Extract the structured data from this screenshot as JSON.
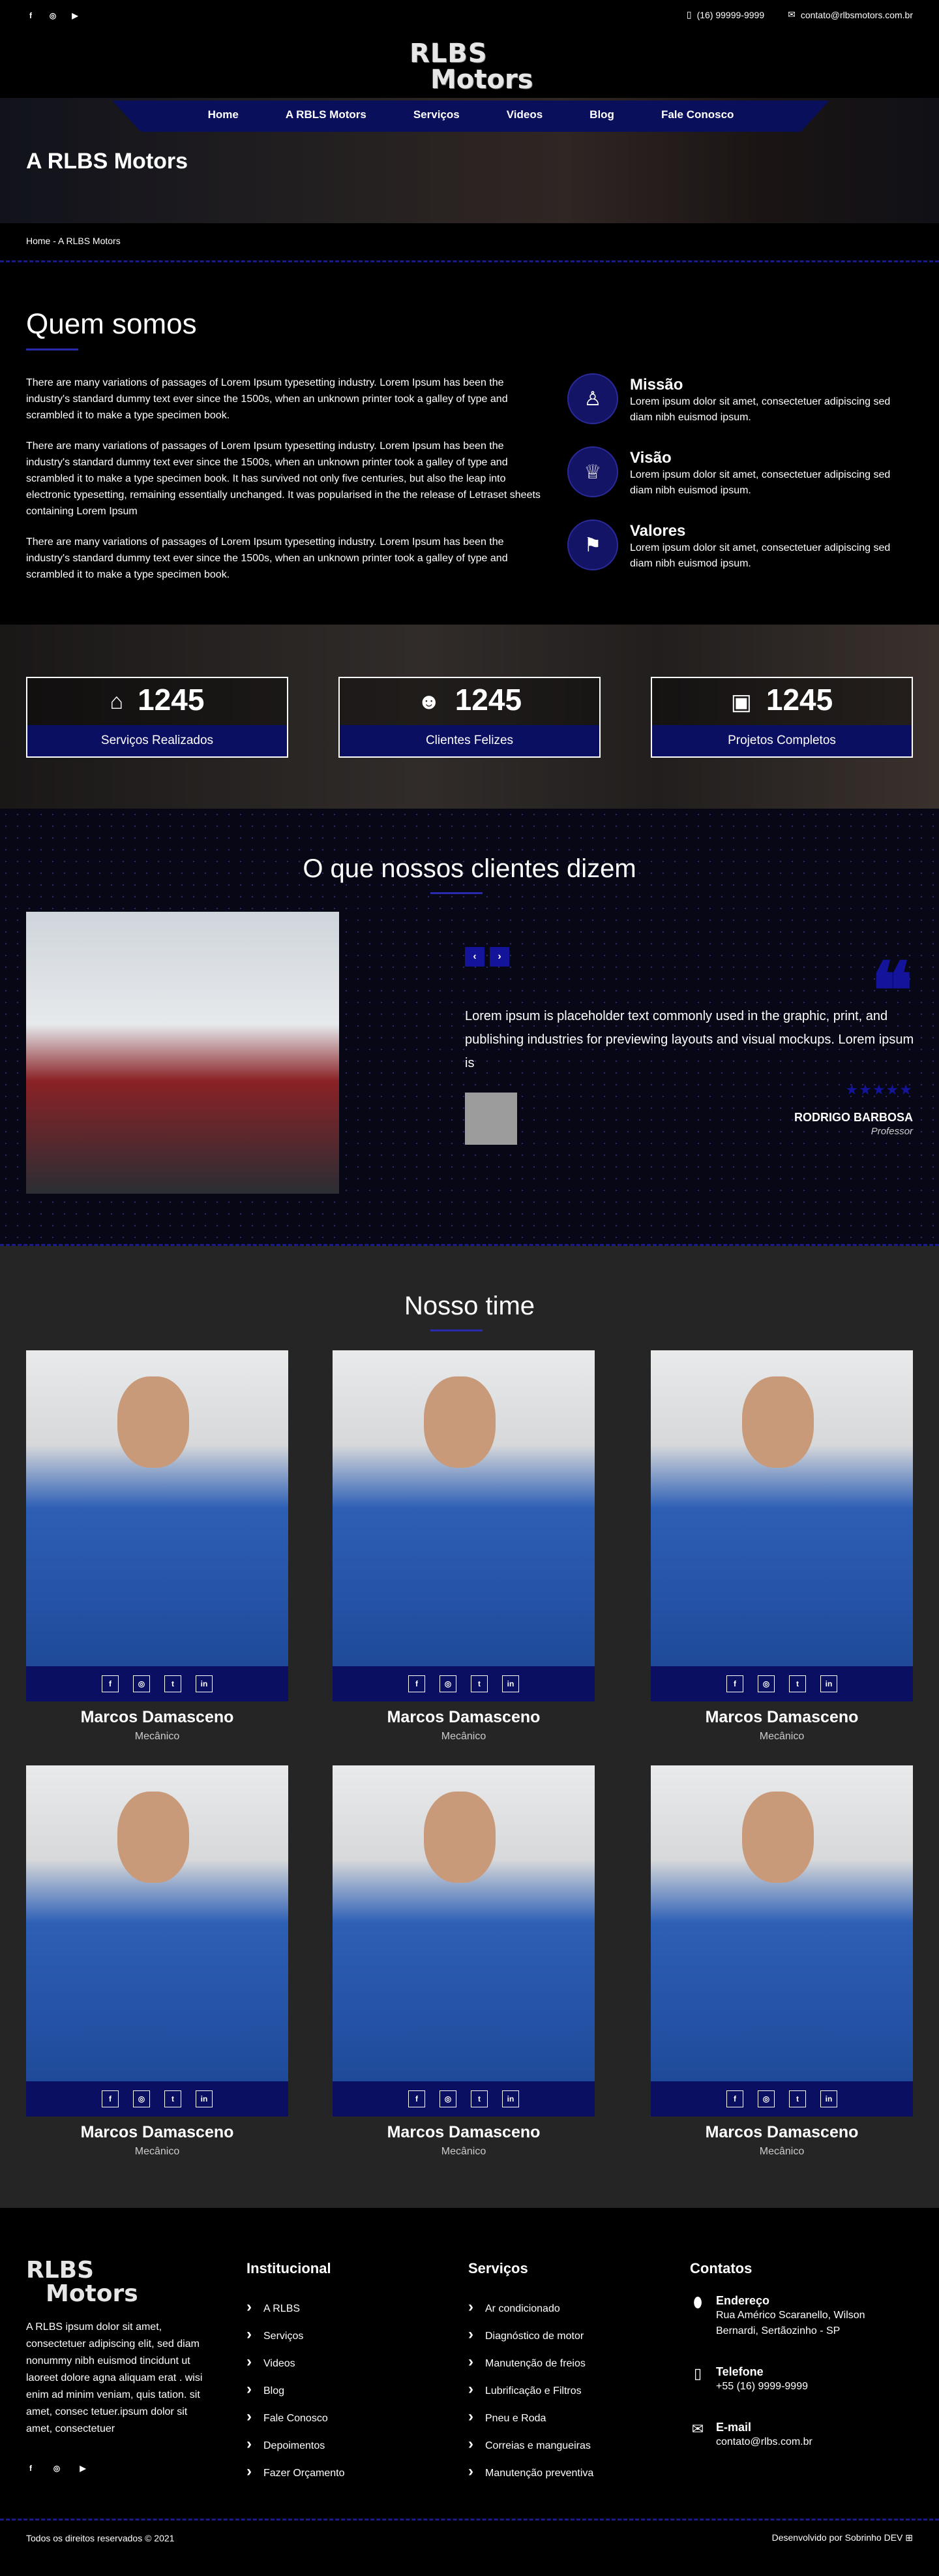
{
  "header": {
    "social": [
      "f",
      "◎",
      "▶"
    ],
    "phone": "(16) 99999-9999",
    "email": "contato@rlbsmotors.com.br",
    "logo_line1": "RLBS",
    "logo_line2": "Motors"
  },
  "nav": [
    "Home",
    "A  RBLS  Motors",
    "Serviços",
    "Videos",
    "Blog",
    "Fale  Conosco"
  ],
  "hero": {
    "title": "A RLBS Motors"
  },
  "breadcrumb": "Home - A RLBS Motors",
  "about": {
    "title": "Quem somos",
    "paragraphs": [
      "There are many variations of passages of Lorem Ipsum typesetting industry. Lorem Ipsum has been the industry's standard dummy text ever since the 1500s, when an unknown printer took a galley of type and scrambled it to make a type specimen book.",
      "There are many variations of passages of Lorem Ipsum typesetting industry. Lorem Ipsum has been the industry's standard dummy text ever since the 1500s, when an unknown printer took a galley of type and scrambled it to make a type specimen book. It has survived not only five centuries, but also the leap into electronic typesetting, remaining essentially unchanged. It was popularised in the the release of Letraset sheets containing Lorem Ipsum",
      "There are many variations of passages of Lorem Ipsum typesetting industry. Lorem Ipsum has been the industry's standard dummy text ever since the 1500s, when an unknown printer took a galley of type and scrambled it to make a type specimen book."
    ],
    "pillars": [
      {
        "title": "Missão",
        "text": "Lorem ipsum dolor sit amet, consectetuer adipiscing sed diam nibh euismod ipsum.",
        "icon": "user-icon"
      },
      {
        "title": "Visão",
        "text": "Lorem ipsum dolor sit amet, consectetuer adipiscing sed diam nibh euismod ipsum.",
        "icon": "trophy-icon"
      },
      {
        "title": "Valores",
        "text": "Lorem ipsum dolor sit amet, consectetuer adipiscing sed diam nibh euismod ipsum.",
        "icon": "flag-icon"
      }
    ]
  },
  "stats": [
    {
      "value": "1245",
      "label": "Serviços Realizados",
      "icon": "home-icon"
    },
    {
      "value": "1245",
      "label": "Clientes Felizes",
      "icon": "users-icon"
    },
    {
      "value": "1245",
      "label": "Projetos Completos",
      "icon": "briefcase-icon"
    }
  ],
  "testimonials": {
    "title": "O que nossos clientes dizem",
    "quote": "Lorem ipsum is placeholder text commonly used in the graphic, print, and publishing industries for previewing layouts and visual mockups. Lorem ipsum is",
    "stars": "★★★★★",
    "name": "RODRIGO BARBOSA",
    "role": "Professor"
  },
  "team": {
    "title": "Nosso time",
    "members": [
      {
        "name": "Marcos Damasceno",
        "role": "Mecânico"
      },
      {
        "name": "Marcos Damasceno",
        "role": "Mecânico"
      },
      {
        "name": "Marcos Damasceno",
        "role": "Mecânico"
      },
      {
        "name": "Marcos Damasceno",
        "role": "Mecânico"
      },
      {
        "name": "Marcos Damasceno",
        "role": "Mecânico"
      },
      {
        "name": "Marcos Damasceno",
        "role": "Mecânico"
      }
    ]
  },
  "footer": {
    "logo_line1": "RLBS",
    "logo_line2": "Motors",
    "description": "A RLBS ipsum dolor sit amet, consectetuer adipiscing elit, sed diam nonummy nibh euismod tincidunt ut laoreet dolore agna aliquam erat . wisi enim ad minim veniam, quis tation. sit amet, consec tetuer.ipsum dolor sit amet, consectetuer",
    "institucional": {
      "title": "Institucional",
      "items": [
        "A RLBS",
        "Serviços",
        "Videos",
        "Blog",
        "Fale Conosco",
        "Depoimentos",
        "Fazer Orçamento"
      ]
    },
    "servicos": {
      "title": "Serviços",
      "items": [
        "Ar condicionado",
        "Diagnóstico de motor",
        "Manutenção de freios",
        "Lubrificação e Filtros",
        "Pneu e Roda",
        "Correias e mangueiras",
        "Manutenção preventiva"
      ]
    },
    "contatos": {
      "title": "Contatos",
      "address_label": "Endereço",
      "address": "Rua Américo Scaranello, Wilson Bernardi, Sertãozinho - SP",
      "phone_label": "Telefone",
      "phone": "+55 (16) 9999-9999",
      "email_label": "E-mail",
      "email": "contato@rlbs.com.br"
    },
    "copyright": "Todos os direitos reservados © 2021",
    "credit": "Desenvolvido por Sobrinho DEV ⊞"
  }
}
